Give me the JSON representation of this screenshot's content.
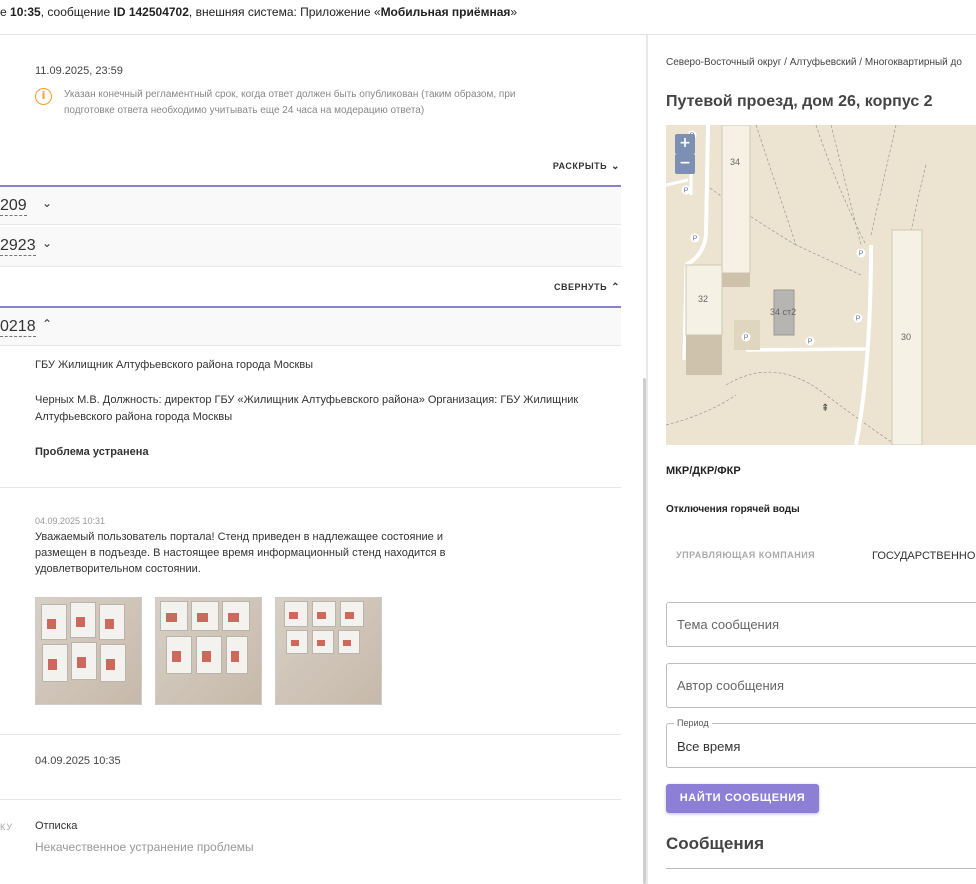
{
  "topbar": {
    "part1": "е ",
    "time": "10:35",
    "part2": ", сообщение ",
    "msg_id": "ID 142504702",
    "part3": ", внешняя система: Приложение «",
    "system": "Мобильная приёмная",
    "part4": "»"
  },
  "deadline": {
    "date": "11.09.2025, 23:59",
    "info_icon": "info-icon",
    "info_text": "Указан конечный регламентный срок, когда ответ должен быть опубликован (таким образом, при подготовке ответа необходимо учитывать еще 24 часа на модерацию ответа)"
  },
  "expand_label": "РАСКРЫТЬ",
  "collapse_label": "СВЕРНУТЬ",
  "accordion": [
    {
      "num": "209",
      "chevron": "⌄"
    },
    {
      "num": "2923",
      "chevron": "⌄"
    },
    {
      "num": "0218",
      "chevron": "⌃"
    }
  ],
  "details": {
    "org": "ГБУ Жилищник Алтуфьевского района города Москвы",
    "responsible": "Черных М.В. Должность: директор ГБУ «Жилищник Алтуфьевского района» Организация: ГБУ Жилищник Алтуфьевского района города Москвы",
    "status": "Проблема устранена"
  },
  "answer": {
    "date": "04.09.2025 10:31",
    "text": "Уважаемый пользователь портала! Стенд приведен в надлежащее состояние и размещен в подъезде. В настоящее время информационный стенд находится в удовлетворительном состоянии."
  },
  "date3": "04.09.2025 10:35",
  "complaint": {
    "cut_label": "КУ",
    "title": "Отписка",
    "subtitle": "Некачественное устранение проблемы"
  },
  "right": {
    "breadcrumb": "Северо-Восточный округ / Алтуфьевский / Многоквартирный до",
    "address": "Путевой проезд, дом 26, корпус 2",
    "map": {
      "zoom_in": "+",
      "zoom_out": "−",
      "labels": {
        "b34": "34",
        "b32": "32",
        "b34c2": "34 ст2",
        "b30": "30",
        "parking": "P",
        "entrance": "⇞"
      }
    },
    "mkr": "МКР/ДКР/ФКР",
    "hot_water": "Отключения горячей воды",
    "tabs": [
      "УПРАВЛЯЮЩАЯ КОМПАНИЯ",
      "ГОСУДАРСТВЕННОЕ"
    ],
    "fields": {
      "topic_placeholder": "Тема сообщения",
      "author_placeholder": "Автор сообщения",
      "period_label": "Период",
      "period_value": "Все время"
    },
    "search_button": "НАЙТИ СООБЩЕНИЯ",
    "messages_title": "Сообщения"
  }
}
